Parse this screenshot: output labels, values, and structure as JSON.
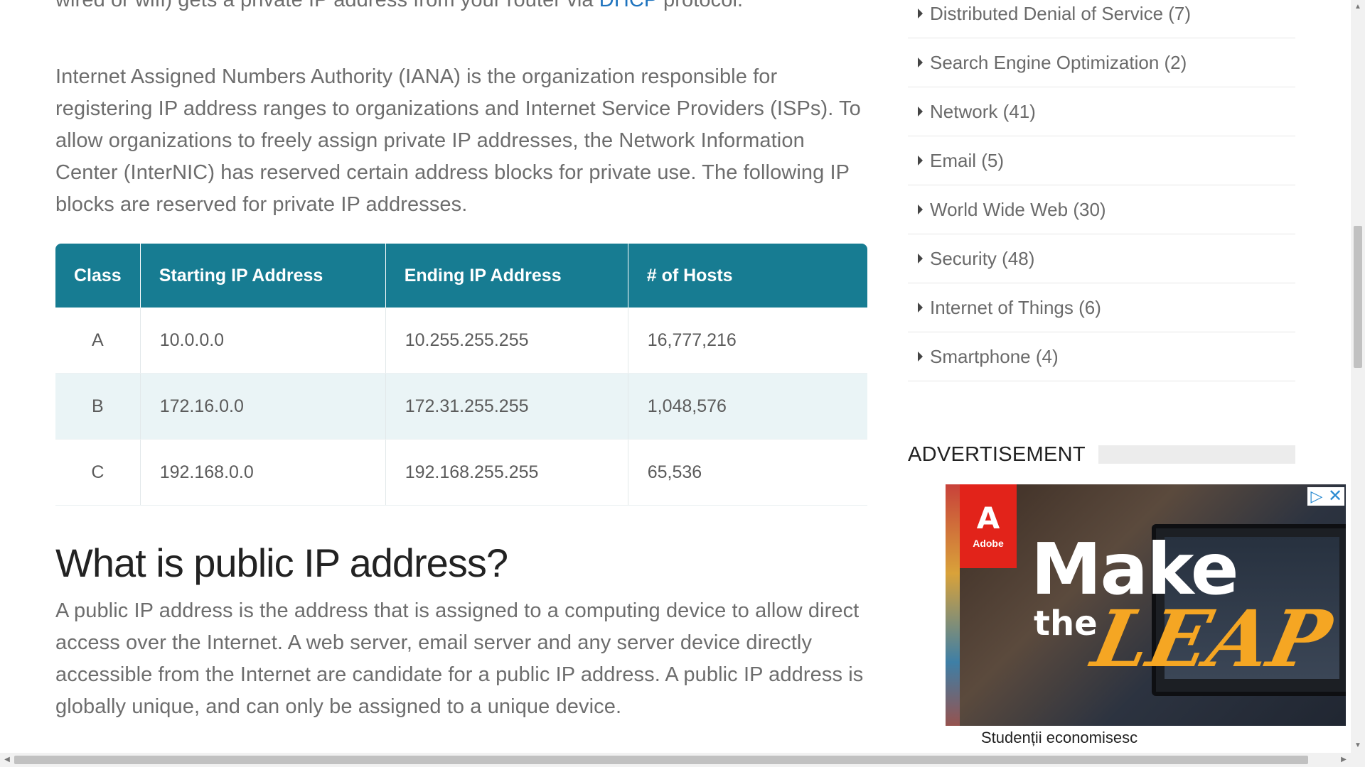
{
  "article": {
    "para_top_text": "wired or wifi) gets a private IP address from your router via ",
    "para_top_link": "DHCP",
    "para_top_tail": " protocol.",
    "para_iana": "Internet Assigned Numbers Authority (IANA) is the organization responsible for registering IP address ranges to organizations and Internet Service Providers (ISPs). To allow organizations to freely assign private IP addresses, the Network Information Center (InterNIC) has reserved certain address blocks for private use. The following IP blocks are reserved for private IP addresses.",
    "table": {
      "headers": [
        "Class",
        "Starting IP Address",
        "Ending IP Address",
        "# of Hosts"
      ],
      "rows": [
        [
          "A",
          "10.0.0.0",
          "10.255.255.255",
          "16,777,216"
        ],
        [
          "B",
          "172.16.0.0",
          "172.31.255.255",
          "1,048,576"
        ],
        [
          "C",
          "192.168.0.0",
          "192.168.255.255",
          "65,536"
        ]
      ]
    },
    "heading_public": "What is public IP address?",
    "para_public": "A public IP address is the address that is assigned to a computing device to allow direct access over the Internet. A web server, email server and any server device directly accessible from the Internet are candidate for a public IP address. A public IP address is globally unique, and can only be assigned to a unique device."
  },
  "sidebar": {
    "categories": [
      {
        "label": "Distributed Denial of Service (7)"
      },
      {
        "label": "Search Engine Optimization (2)"
      },
      {
        "label": "Network (41)"
      },
      {
        "label": "Email (5)"
      },
      {
        "label": "World Wide Web (30)"
      },
      {
        "label": "Security (48)"
      },
      {
        "label": "Internet of Things (6)"
      },
      {
        "label": "Smartphone (4)"
      }
    ],
    "advertisement_heading": "ADVERTISEMENT"
  },
  "ad": {
    "brand": "Adobe",
    "brand_mark": "A",
    "line1": "Make",
    "line2": "the",
    "line3": "LEAP",
    "bottom_text": "Studenții economisesc"
  },
  "colors": {
    "table_header": "#177c92",
    "link": "#1e73be",
    "ad_accent": "#f5a623",
    "adobe_red": "#e2231a"
  }
}
